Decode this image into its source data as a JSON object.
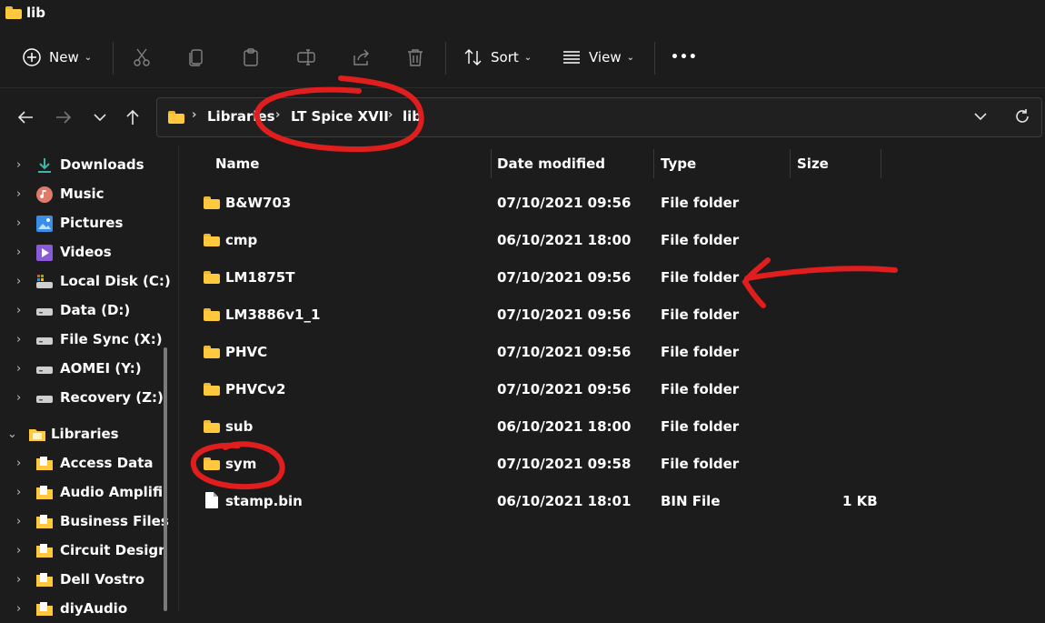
{
  "window": {
    "title": "lib"
  },
  "toolbar": {
    "new_label": "New",
    "sort_label": "Sort",
    "view_label": "View",
    "more_label": "•••"
  },
  "address": {
    "crumbs": [
      "Libraries",
      "LT Spice XVII",
      "lib"
    ]
  },
  "sidebar": {
    "items": [
      {
        "label": "Downloads",
        "icon": "download-icon"
      },
      {
        "label": "Music",
        "icon": "music-icon"
      },
      {
        "label": "Pictures",
        "icon": "pictures-icon"
      },
      {
        "label": "Videos",
        "icon": "videos-icon"
      },
      {
        "label": "Local Disk (C:)",
        "icon": "system-drive-icon"
      },
      {
        "label": "Data (D:)",
        "icon": "drive-icon"
      },
      {
        "label": "File Sync (X:)",
        "icon": "drive-icon"
      },
      {
        "label": "AOMEI (Y:)",
        "icon": "drive-icon"
      },
      {
        "label": "Recovery (Z:)",
        "icon": "drive-icon"
      },
      {
        "label": "Libraries",
        "icon": "libraries-icon"
      },
      {
        "label": "Access Data",
        "icon": "library-folder-icon"
      },
      {
        "label": "Audio Amplifi",
        "icon": "library-folder-icon"
      },
      {
        "label": "Business Files",
        "icon": "library-folder-icon"
      },
      {
        "label": "Circuit Design",
        "icon": "library-folder-icon"
      },
      {
        "label": "Dell Vostro",
        "icon": "library-folder-icon"
      },
      {
        "label": "diyAudio",
        "icon": "library-folder-icon"
      }
    ]
  },
  "columns": {
    "name": "Name",
    "date": "Date modified",
    "type": "Type",
    "size": "Size"
  },
  "files": [
    {
      "name": "B&W703",
      "date": "07/10/2021 09:56",
      "type": "File folder",
      "size": "",
      "icon": "folder-icon"
    },
    {
      "name": "cmp",
      "date": "06/10/2021 18:00",
      "type": "File folder",
      "size": "",
      "icon": "folder-icon"
    },
    {
      "name": "LM1875T",
      "date": "07/10/2021 09:56",
      "type": "File folder",
      "size": "",
      "icon": "folder-icon"
    },
    {
      "name": "LM3886v1_1",
      "date": "07/10/2021 09:56",
      "type": "File folder",
      "size": "",
      "icon": "folder-icon"
    },
    {
      "name": "PHVC",
      "date": "07/10/2021 09:56",
      "type": "File folder",
      "size": "",
      "icon": "folder-icon"
    },
    {
      "name": "PHVCv2",
      "date": "07/10/2021 09:56",
      "type": "File folder",
      "size": "",
      "icon": "folder-icon"
    },
    {
      "name": "sub",
      "date": "06/10/2021 18:00",
      "type": "File folder",
      "size": "",
      "icon": "folder-icon"
    },
    {
      "name": "sym",
      "date": "07/10/2021 09:58",
      "type": "File folder",
      "size": "",
      "icon": "folder-icon"
    },
    {
      "name": "stamp.bin",
      "date": "06/10/2021 18:01",
      "type": "BIN File",
      "size": "1 KB",
      "icon": "file-icon"
    }
  ],
  "colors": {
    "background": "#1c1c1c",
    "folder": "#ffc83d",
    "annotation": "#e01e1e"
  }
}
